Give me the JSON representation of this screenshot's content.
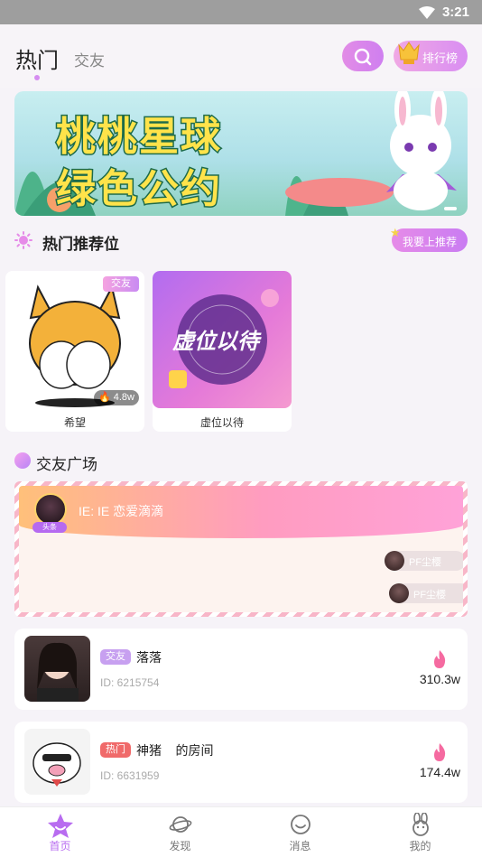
{
  "status_bar": {
    "time": "3:21"
  },
  "header": {
    "tab_active": "热门",
    "tab_inactive": "交友",
    "rank_label": "排行榜"
  },
  "banner": {
    "line1": "桃桃星球",
    "line2": "绿色公约"
  },
  "recommend": {
    "title": "热门推荐位",
    "action": "我要上推荐",
    "cards": [
      {
        "name": "希望",
        "badge": "交友",
        "heat": "4.8w"
      },
      {
        "name": "虚位以待",
        "art_text": "虚位以待"
      }
    ]
  },
  "plaza": {
    "title": "交友广场",
    "headline": {
      "tag": "头条",
      "text": "IE: IE  恋爱滴滴"
    },
    "chips": [
      "PF尘樱",
      "PF尘樱"
    ]
  },
  "rooms": [
    {
      "tag": "交友",
      "tag_color": "#c7a0f0",
      "title": "落落",
      "id": "ID: 6215754",
      "heat": "310.3w"
    },
    {
      "tag": "热门",
      "tag_color": "#f06a6a",
      "title": "神猪    的房间",
      "id": "ID: 6631959",
      "heat": "174.4w"
    }
  ],
  "nav": [
    {
      "label": "首页",
      "icon": "home-star-icon"
    },
    {
      "label": "发现",
      "icon": "planet-icon"
    },
    {
      "label": "消息",
      "icon": "chat-smile-icon"
    },
    {
      "label": "我的",
      "icon": "bunny-icon"
    }
  ]
}
